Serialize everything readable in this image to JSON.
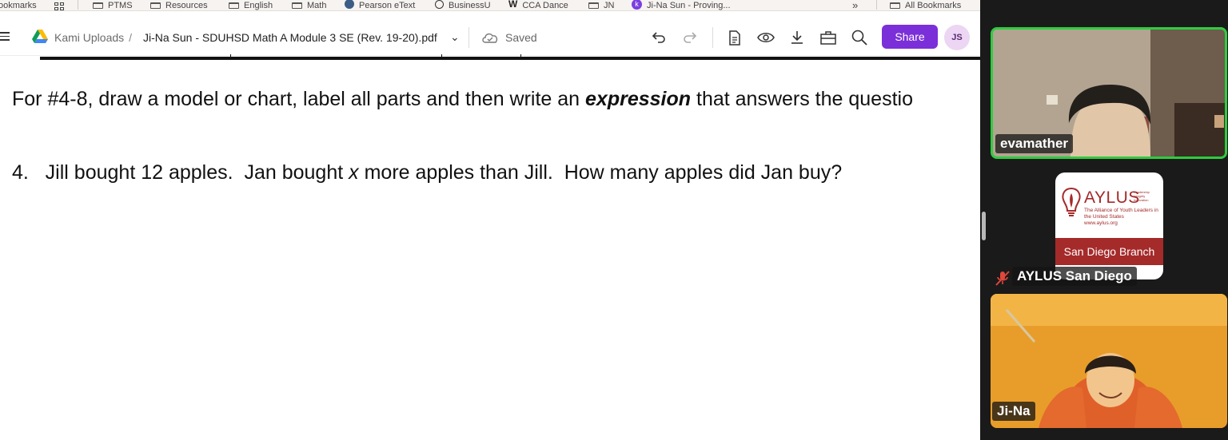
{
  "bookmarks": {
    "items": [
      {
        "label": "ookmarks",
        "icon": "text"
      },
      {
        "label": "",
        "icon": "apps-grid-icon"
      },
      {
        "label": "PTMS",
        "icon": "folder-icon"
      },
      {
        "label": "Resources",
        "icon": "folder-icon"
      },
      {
        "label": "English",
        "icon": "folder-icon"
      },
      {
        "label": "Math",
        "icon": "folder-icon"
      },
      {
        "label": "Pearson eText",
        "icon": "pearson-icon"
      },
      {
        "label": "BusinessU",
        "icon": "globe-icon"
      },
      {
        "label": "CCA Dance",
        "icon": "w-icon"
      },
      {
        "label": "JN",
        "icon": "folder-icon"
      },
      {
        "label": "Ji-Na Sun - Proving...",
        "icon": "k-icon"
      }
    ],
    "overflow": "»",
    "all_bookmarks": "All Bookmarks"
  },
  "toolbar": {
    "breadcrumb_root": "Kami Uploads",
    "breadcrumb_sep": "/",
    "filename": "Ji-Na Sun - SDUHSD Math A Module 3 SE (Rev. 19-20).pdf",
    "chevron": "⌄",
    "saved": "Saved",
    "share_label": "Share",
    "avatar_initials": "JS",
    "accent": "#7b2fd8"
  },
  "document": {
    "instruction_pre": "For #4-8, draw a model or chart, label all parts and then write an ",
    "instruction_em": "expression",
    "instruction_post": " that answers the questio",
    "q4_pre": "4.   Jill bought 12 apples.  Jan bought ",
    "q4_var": "x",
    "q4_post": " more apples than Jill.  How many apples did Jan buy?"
  },
  "zoom": {
    "participants": [
      {
        "name": "evamather",
        "active_speaker": true,
        "highlight": "#2ecc40"
      },
      {
        "name": "AYLUS San Diego",
        "muted": true
      },
      {
        "name": "Ji-Na"
      }
    ],
    "aylus": {
      "title": "AYLUS",
      "tagline": "Leadership\nIntegrity\nInnovation",
      "subtitle": "The Alliance of Youth Leaders in the United States",
      "url": "www.aylus.org",
      "branch": "San Diego Branch"
    }
  }
}
